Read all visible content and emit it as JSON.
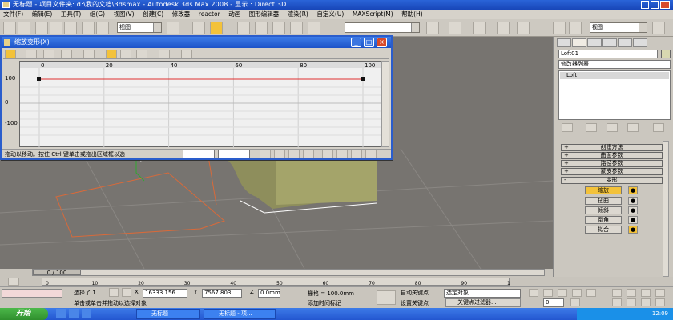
{
  "app": {
    "title": "无标题  - 项目文件夹: d:\\我的文档\\3dsmax  - Autodesk 3ds Max 2008  - 显示 : Direct 3D"
  },
  "menu": [
    "文件(F)",
    "编辑(E)",
    "工具(T)",
    "组(G)",
    "视图(V)",
    "创建(C)",
    "修改器",
    "reactor",
    "动画",
    "图形编辑器",
    "渲染(R)",
    "自定义(U)",
    "MAXScript(M)",
    "帮助(H)"
  ],
  "toolbar": {
    "view_combo": "视图",
    "view_combo2": "视图"
  },
  "dialog": {
    "title": "缩放变形(X)",
    "ticks_x": [
      "0",
      "20",
      "40",
      "60",
      "80",
      "100"
    ],
    "ticks_y": [
      "100",
      "0",
      "-100"
    ],
    "status_text": "拖动以移动。按住 Ctrl 键单击或拖出区域框以选",
    "x_value": "",
    "y_value": ""
  },
  "command_panel": {
    "object_name": "Loft01",
    "modifier_list": "修改器列表",
    "stack_item": "Loft",
    "rollouts": [
      {
        "sign": "+",
        "label": "创建方法"
      },
      {
        "sign": "+",
        "label": "曲面参数"
      },
      {
        "sign": "+",
        "label": "路径参数"
      },
      {
        "sign": "+",
        "label": "蒙皮参数"
      },
      {
        "sign": "-",
        "label": "变形"
      }
    ],
    "deform_buttons": [
      {
        "label": "缩放",
        "active": true
      },
      {
        "label": "扭曲",
        "active": false
      },
      {
        "label": "倾斜",
        "active": false
      },
      {
        "label": "倒角",
        "active": false
      },
      {
        "label": "拟合",
        "active": false
      }
    ]
  },
  "timeline": {
    "position": "0 / 100",
    "ticks": [
      "0",
      "10",
      "20",
      "30",
      "40",
      "50",
      "60",
      "70",
      "80",
      "90",
      "100"
    ]
  },
  "statusbar": {
    "selected": "选择了 1",
    "x": "16333.156",
    "y": "7567.803",
    "z": "0.0mm",
    "grid": "栅格 = 100.0mm",
    "prompt": "单击或单击并拖动以选择对象",
    "add_tag": "添加时间标记",
    "auto_key": "自动关键点",
    "set_key": "设置关键点",
    "key_filter": "关键点过滤器...",
    "selection_set": "选定对象",
    "frame": "0"
  },
  "taskbar": {
    "start": "开始",
    "tasks": [
      "无标题",
      "无标题 - 项..."
    ],
    "clock": "12:09"
  },
  "colors": {
    "accent": "#f3c23a",
    "title_blue": "#1c52c8",
    "curve": "#e03030"
  }
}
